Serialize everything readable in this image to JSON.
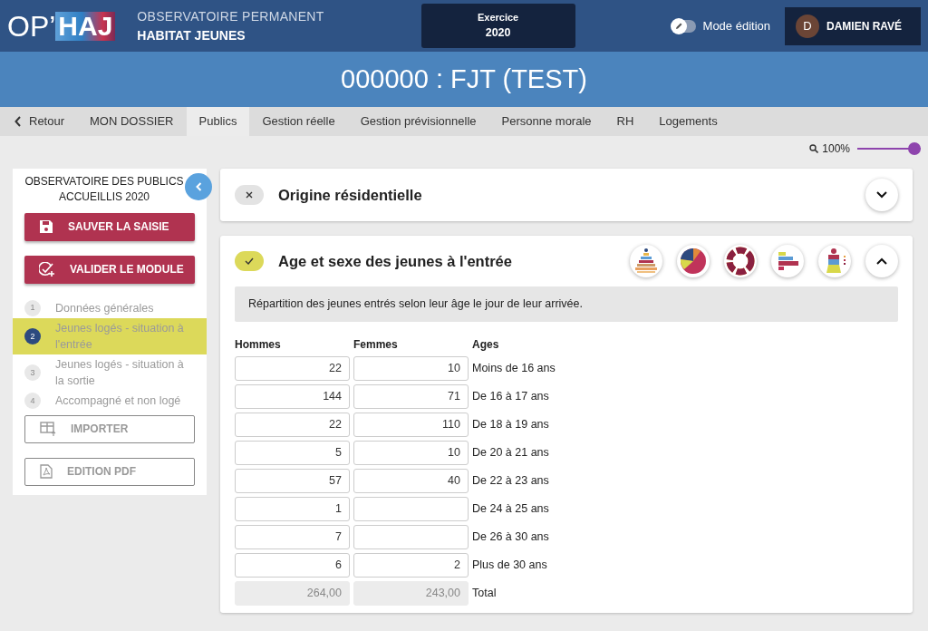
{
  "header": {
    "logo_prefix": "OP’",
    "logo_main": "HAJ",
    "title_line_1": "OBSERVATOIRE PERMANENT",
    "title_line_2": "HABITAT JEUNES",
    "exercise": {
      "label": "Exercice",
      "value": "2020"
    },
    "edit_mode": {
      "label": "Mode édition",
      "on": false
    },
    "user": {
      "initial": "D",
      "name": "DAMIEN RAVÉ"
    }
  },
  "banner": {
    "title": "000000 : FJT (TEST)"
  },
  "tabs": {
    "back": "Retour",
    "items": [
      {
        "label": "MON DOSSIER",
        "selected": false
      },
      {
        "label": "Publics",
        "selected": true
      },
      {
        "label": "Gestion réelle",
        "selected": false
      },
      {
        "label": "Gestion prévisionnelle",
        "selected": false
      },
      {
        "label": "Personne morale",
        "selected": false
      },
      {
        "label": "RH",
        "selected": false
      },
      {
        "label": "Logements",
        "selected": false
      }
    ]
  },
  "zoom": {
    "label": "100%",
    "level": 1
  },
  "sidebar": {
    "title": "OBSERVATOIRE DES PUBLICS ACCUEILLIS 2020",
    "save_button": "SAUVER LA SAISIE",
    "validate_button": "VALIDER LE MODULE",
    "steps": [
      {
        "number": "1",
        "label": "Données générales",
        "selected": false
      },
      {
        "number": "2",
        "label": "Jeunes logés - situation à l'entrée",
        "selected": true
      },
      {
        "number": "3",
        "label": "Jeunes logés - situation à la sortie",
        "selected": false
      },
      {
        "number": "4",
        "label": "Accompagné et non logé",
        "selected": false
      }
    ],
    "import_button": "IMPORTER",
    "pdf_button": "EDITION PDF"
  },
  "sections": [
    {
      "title": "Origine résidentielle",
      "validated": false,
      "expanded": false
    },
    {
      "title": "Age et sexe des jeunes à l'entrée",
      "validated": true,
      "expanded": true,
      "description": "Répartition des jeunes entrés selon leur âge le jour de leur arrivée.",
      "columns": [
        "Hommes",
        "Femmes",
        "Ages"
      ],
      "rows": [
        {
          "hommes": "22",
          "femmes": "10",
          "age": "Moins de 16 ans"
        },
        {
          "hommes": "144",
          "femmes": "71",
          "age": "De 16 à 17 ans"
        },
        {
          "hommes": "22",
          "femmes": "110",
          "age": "De 18 à 19 ans"
        },
        {
          "hommes": "5",
          "femmes": "10",
          "age": "De 20 à 21 ans"
        },
        {
          "hommes": "57",
          "femmes": "40",
          "age": "De 22 à 23 ans"
        },
        {
          "hommes": "1",
          "age": "De 24 à 25 ans"
        },
        {
          "hommes": "7",
          "age": "De 26 à 30 ans"
        },
        {
          "hommes": "6",
          "femmes": "2",
          "age": "Plus de 30 ans"
        }
      ],
      "total": {
        "hommes": "264,00",
        "femmes": "243,00",
        "label": "Total"
      }
    }
  ]
}
